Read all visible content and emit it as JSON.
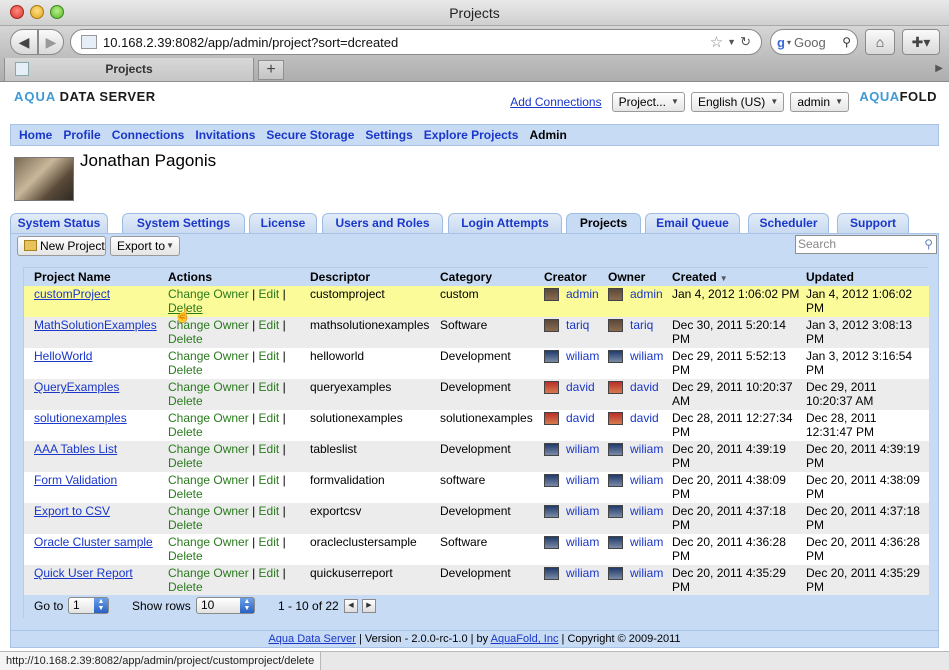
{
  "window": {
    "title": "Projects"
  },
  "browser": {
    "url": "10.168.2.39:8082/app/admin/project?sort=dcreated",
    "search_placeholder": "Goog",
    "tab_label": "Projects"
  },
  "header": {
    "logo_left": {
      "line1": "AQUA",
      "line2": "DATA SERVER"
    },
    "add_connections": "Add Connections",
    "project_select": "Project...",
    "language_select": "English (US)",
    "user_select": "admin",
    "logo_right": {
      "line1": "AQUA",
      "line2": "FOLD"
    }
  },
  "nav": {
    "items": [
      "Home",
      "Profile",
      "Connections",
      "Invitations",
      "Secure Storage",
      "Settings",
      "Explore Projects",
      "Admin"
    ],
    "current": "Admin"
  },
  "profile": {
    "name": "Jonathan Pagonis"
  },
  "subtabs": [
    "System Status",
    "System Settings",
    "License",
    "Users and Roles",
    "Login Attempts",
    "Projects",
    "Email Queue",
    "Scheduler",
    "Support"
  ],
  "toolbar": {
    "new_project": "New Project",
    "export_to": "Export to",
    "search_placeholder": "Search"
  },
  "table": {
    "headers": [
      "Project Name",
      "Actions",
      "Descriptor",
      "Category",
      "Creator",
      "Owner",
      "Created",
      "Updated"
    ],
    "action_labels": {
      "change_owner": "Change Owner",
      "edit": "Edit",
      "delete": "Delete",
      "sep": "|"
    },
    "rows": [
      {
        "name": "customProject",
        "descriptor": "customproject",
        "category": "custom",
        "creator": "admin",
        "owner": "admin",
        "created": "Jan 4, 2012 1:06:02 PM",
        "updated": "Jan 4, 2012 1:06:02 PM"
      },
      {
        "name": "MathSolutionExamples",
        "descriptor": "mathsolutionexamples",
        "category": "Software",
        "creator": "tariq",
        "owner": "tariq",
        "created": "Dec 30, 2011 5:20:14 PM",
        "updated": "Jan 3, 2012 3:08:13 PM"
      },
      {
        "name": "HelloWorld",
        "descriptor": "helloworld",
        "category": "Development",
        "creator": "wiliam",
        "owner": "wiliam",
        "created": "Dec 29, 2011 5:52:13 PM",
        "updated": "Jan 3, 2012 3:16:54 PM"
      },
      {
        "name": "QueryExamples",
        "descriptor": "queryexamples",
        "category": "Development",
        "creator": "david",
        "owner": "david",
        "created": "Dec 29, 2011 10:20:37 AM",
        "updated": "Dec 29, 2011 10:20:37 AM"
      },
      {
        "name": "solutionexamples",
        "descriptor": "solutionexamples",
        "category": "solutionexamples",
        "creator": "david",
        "owner": "david",
        "created": "Dec 28, 2011 12:27:34 PM",
        "updated": "Dec 28, 2011 12:31:47 PM"
      },
      {
        "name": "AAA Tables List",
        "descriptor": "tableslist",
        "category": "Development",
        "creator": "wiliam",
        "owner": "wiliam",
        "created": "Dec 20, 2011 4:39:19 PM",
        "updated": "Dec 20, 2011 4:39:19 PM"
      },
      {
        "name": "Form Validation",
        "descriptor": "formvalidation",
        "category": "software",
        "creator": "wiliam",
        "owner": "wiliam",
        "created": "Dec 20, 2011 4:38:09 PM",
        "updated": "Dec 20, 2011 4:38:09 PM"
      },
      {
        "name": "Export to CSV",
        "descriptor": "exportcsv",
        "category": "Development",
        "creator": "wiliam",
        "owner": "wiliam",
        "created": "Dec 20, 2011 4:37:18 PM",
        "updated": "Dec 20, 2011 4:37:18 PM"
      },
      {
        "name": "Oracle Cluster sample",
        "descriptor": "oracleclustersample",
        "category": "Software",
        "creator": "wiliam",
        "owner": "wiliam",
        "created": "Dec 20, 2011 4:36:28 PM",
        "updated": "Dec 20, 2011 4:36:28 PM"
      },
      {
        "name": "Quick User Report",
        "descriptor": "quickuserreport",
        "category": "Development",
        "creator": "wiliam",
        "owner": "wiliam",
        "created": "Dec 20, 2011 4:35:29 PM",
        "updated": "Dec 20, 2011 4:35:29 PM"
      }
    ]
  },
  "pager": {
    "goto_label": "Go to",
    "goto_value": "1",
    "rows_label": "Show rows",
    "rows_value": "10",
    "range": "1 - 10 of 22"
  },
  "footer": {
    "product": "Aqua Data Server",
    "version": " | Version - 2.0.0-rc-1.0 | by ",
    "company": "AquaFold, Inc",
    "copyright": " | Copyright © 2009-2011"
  },
  "status": {
    "text": "http://10.168.2.39:8082/app/admin/project/customproject/delete"
  }
}
